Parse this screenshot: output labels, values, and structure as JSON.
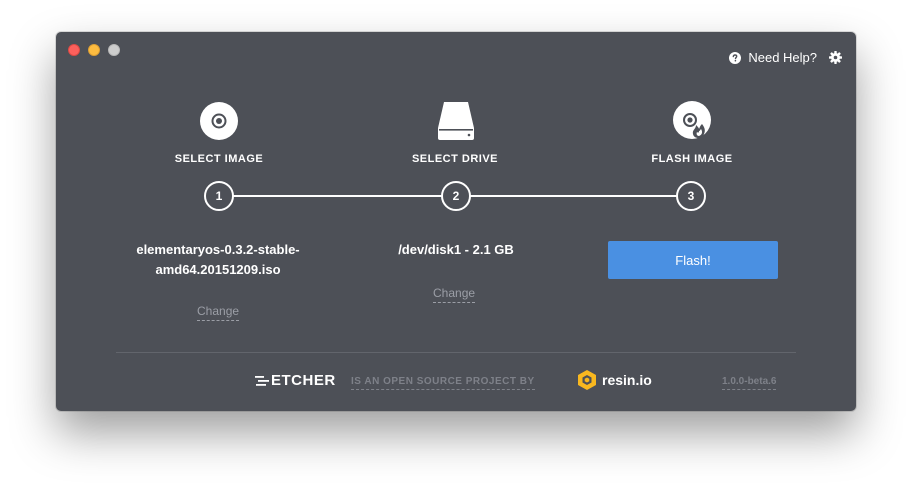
{
  "header": {
    "help_label": "Need Help?"
  },
  "steps": [
    {
      "title": "SELECT IMAGE",
      "number": "1",
      "icon": "disc-icon"
    },
    {
      "title": "SELECT DRIVE",
      "number": "2",
      "icon": "drive-icon"
    },
    {
      "title": "FLASH IMAGE",
      "number": "3",
      "icon": "flash-disc-icon"
    }
  ],
  "image": {
    "line1": "elementaryos-0.3.2-stable-",
    "line2": "amd64.20151209.iso",
    "change_label": "Change"
  },
  "drive": {
    "label": "/dev/disk1 - 2.1 GB",
    "change_label": "Change"
  },
  "flash": {
    "button_label": "Flash!"
  },
  "footer": {
    "etcher_label": "ETCHER",
    "project_text": "IS AN OPEN SOURCE PROJECT BY",
    "resin_label": "resin.io",
    "version": "1.0.0-beta.6"
  },
  "colors": {
    "window_bg": "#4d5057",
    "accent": "#4a90e2",
    "muted_text": "#9b9ea6",
    "resin_yellow": "#f9b81f"
  }
}
